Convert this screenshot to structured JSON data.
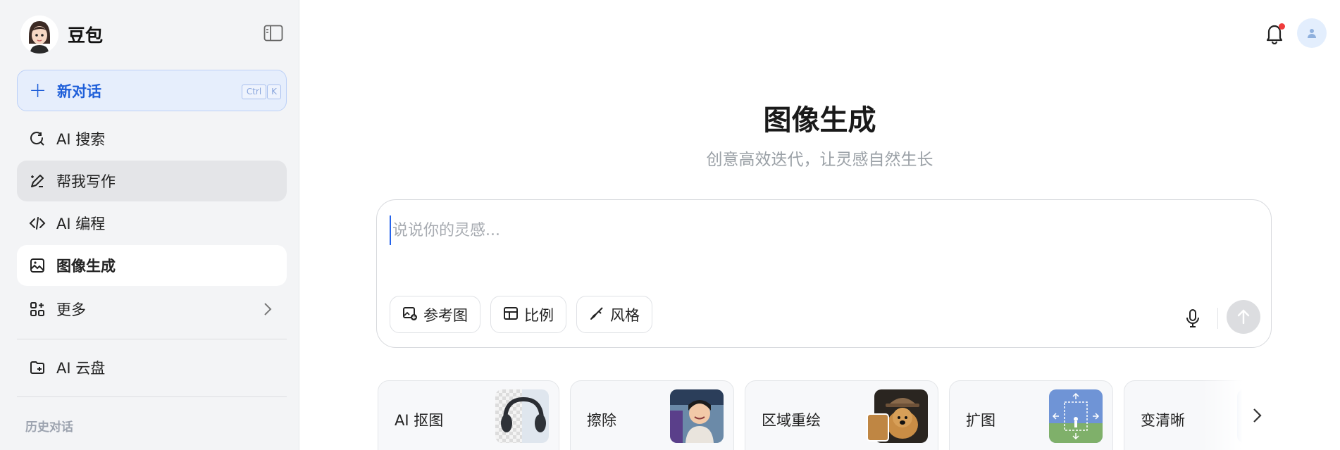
{
  "app": {
    "name": "豆包"
  },
  "sidebar": {
    "new_chat": {
      "label": "新对话",
      "shortcut_ctrl": "Ctrl",
      "shortcut_key": "K"
    },
    "items": [
      {
        "label": "AI 搜索",
        "icon": "search-refresh-icon"
      },
      {
        "label": "帮我写作",
        "icon": "pen-sparkle-icon"
      },
      {
        "label": "AI 编程",
        "icon": "code-icon"
      },
      {
        "label": "图像生成",
        "icon": "image-icon"
      },
      {
        "label": "更多",
        "icon": "grid-plus-icon"
      },
      {
        "label": "AI 云盘",
        "icon": "folder-plus-icon"
      }
    ],
    "history_label": "历史对话"
  },
  "main": {
    "title": "图像生成",
    "subtitle": "创意高效迭代，让灵感自然生长",
    "input_placeholder": "说说你的灵感...",
    "tools": [
      {
        "label": "参考图",
        "icon": "image-add-icon"
      },
      {
        "label": "比例",
        "icon": "aspect-ratio-icon"
      },
      {
        "label": "风格",
        "icon": "brush-icon"
      }
    ],
    "cards": [
      {
        "label": "AI 抠图"
      },
      {
        "label": "擦除"
      },
      {
        "label": "区域重绘"
      },
      {
        "label": "扩图"
      },
      {
        "label": "变清晰"
      }
    ]
  },
  "colors": {
    "accent": "#1f5fd9",
    "notification": "#ef3b3b"
  }
}
